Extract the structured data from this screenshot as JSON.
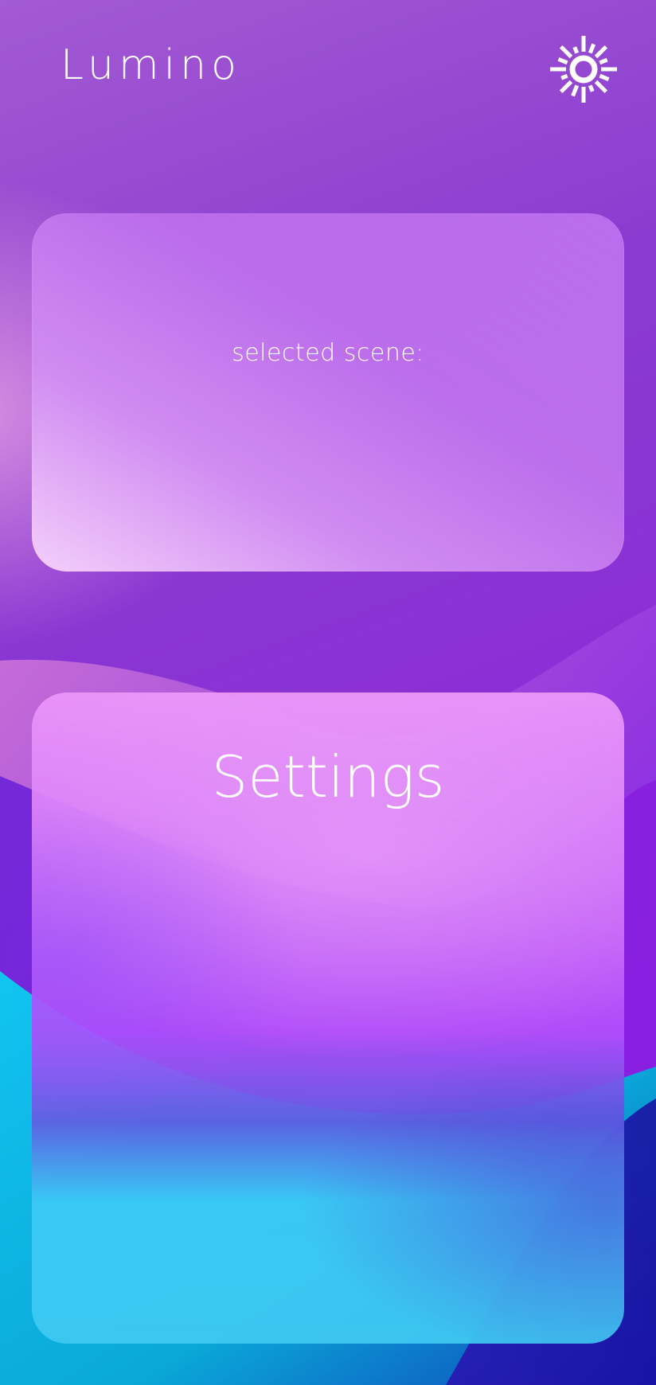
{
  "app": {
    "title": "Lumino",
    "logo_icon": "sunburst-icon"
  },
  "scene_card": {
    "label": "selected scene:"
  },
  "settings_card": {
    "title": "Settings"
  },
  "colors": {
    "background_purple": "#8a3bd0",
    "accent_cyan": "#3ec8f0",
    "text": "#ffffff"
  }
}
